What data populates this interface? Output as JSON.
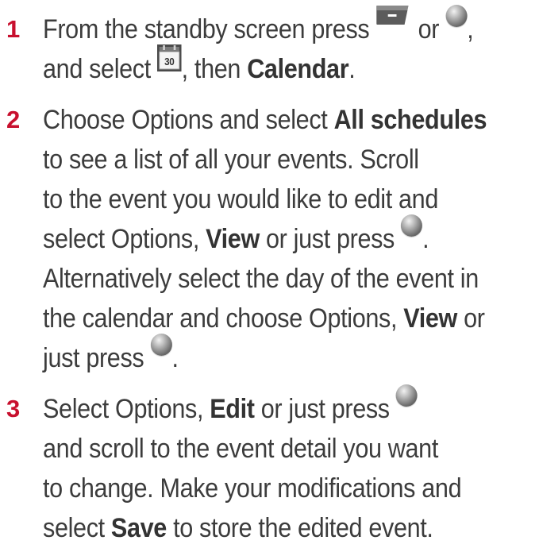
{
  "steps": [
    {
      "number": "1",
      "lines": [
        {
          "t1": "From the standby screen press ",
          "t2": " or ",
          "t3": ","
        },
        {
          "t1": "and select ",
          "t2": ", then ",
          "b1": "Calendar",
          "t3": "."
        }
      ]
    },
    {
      "number": "2",
      "lines": [
        {
          "t1": "Choose Options and select ",
          "b1": "All schedules"
        },
        {
          "t1": "to see a list of all your events. Scroll"
        },
        {
          "t1": "to the event you would like to edit and"
        },
        {
          "t1": "select Options, ",
          "b1": "View",
          "t2": " or just press ",
          "t3": "."
        },
        {
          "t1": "Alternatively select the day of the event in"
        },
        {
          "t1": "the calendar and choose Options, ",
          "b1": "View",
          "t2": " or"
        },
        {
          "t1": "just press ",
          "t2": "."
        }
      ]
    },
    {
      "number": "3",
      "lines": [
        {
          "t1": "Select Options, ",
          "b1": "Edit",
          "t2": " or just press"
        },
        {
          "t1": "and scroll to the event detail you want"
        },
        {
          "t1": "to change. Make your modifications and"
        },
        {
          "t1": "select ",
          "b1": "Save",
          "t2": " to store the edited event."
        }
      ]
    }
  ],
  "icons": {
    "softkey": "left-soft-key-icon",
    "ok": "ok-key-icon",
    "calendar": "calendar-organiser-icon",
    "calendar_label": "30"
  },
  "colors": {
    "step_number": "#c8102e",
    "text": "#3c3c3c"
  }
}
